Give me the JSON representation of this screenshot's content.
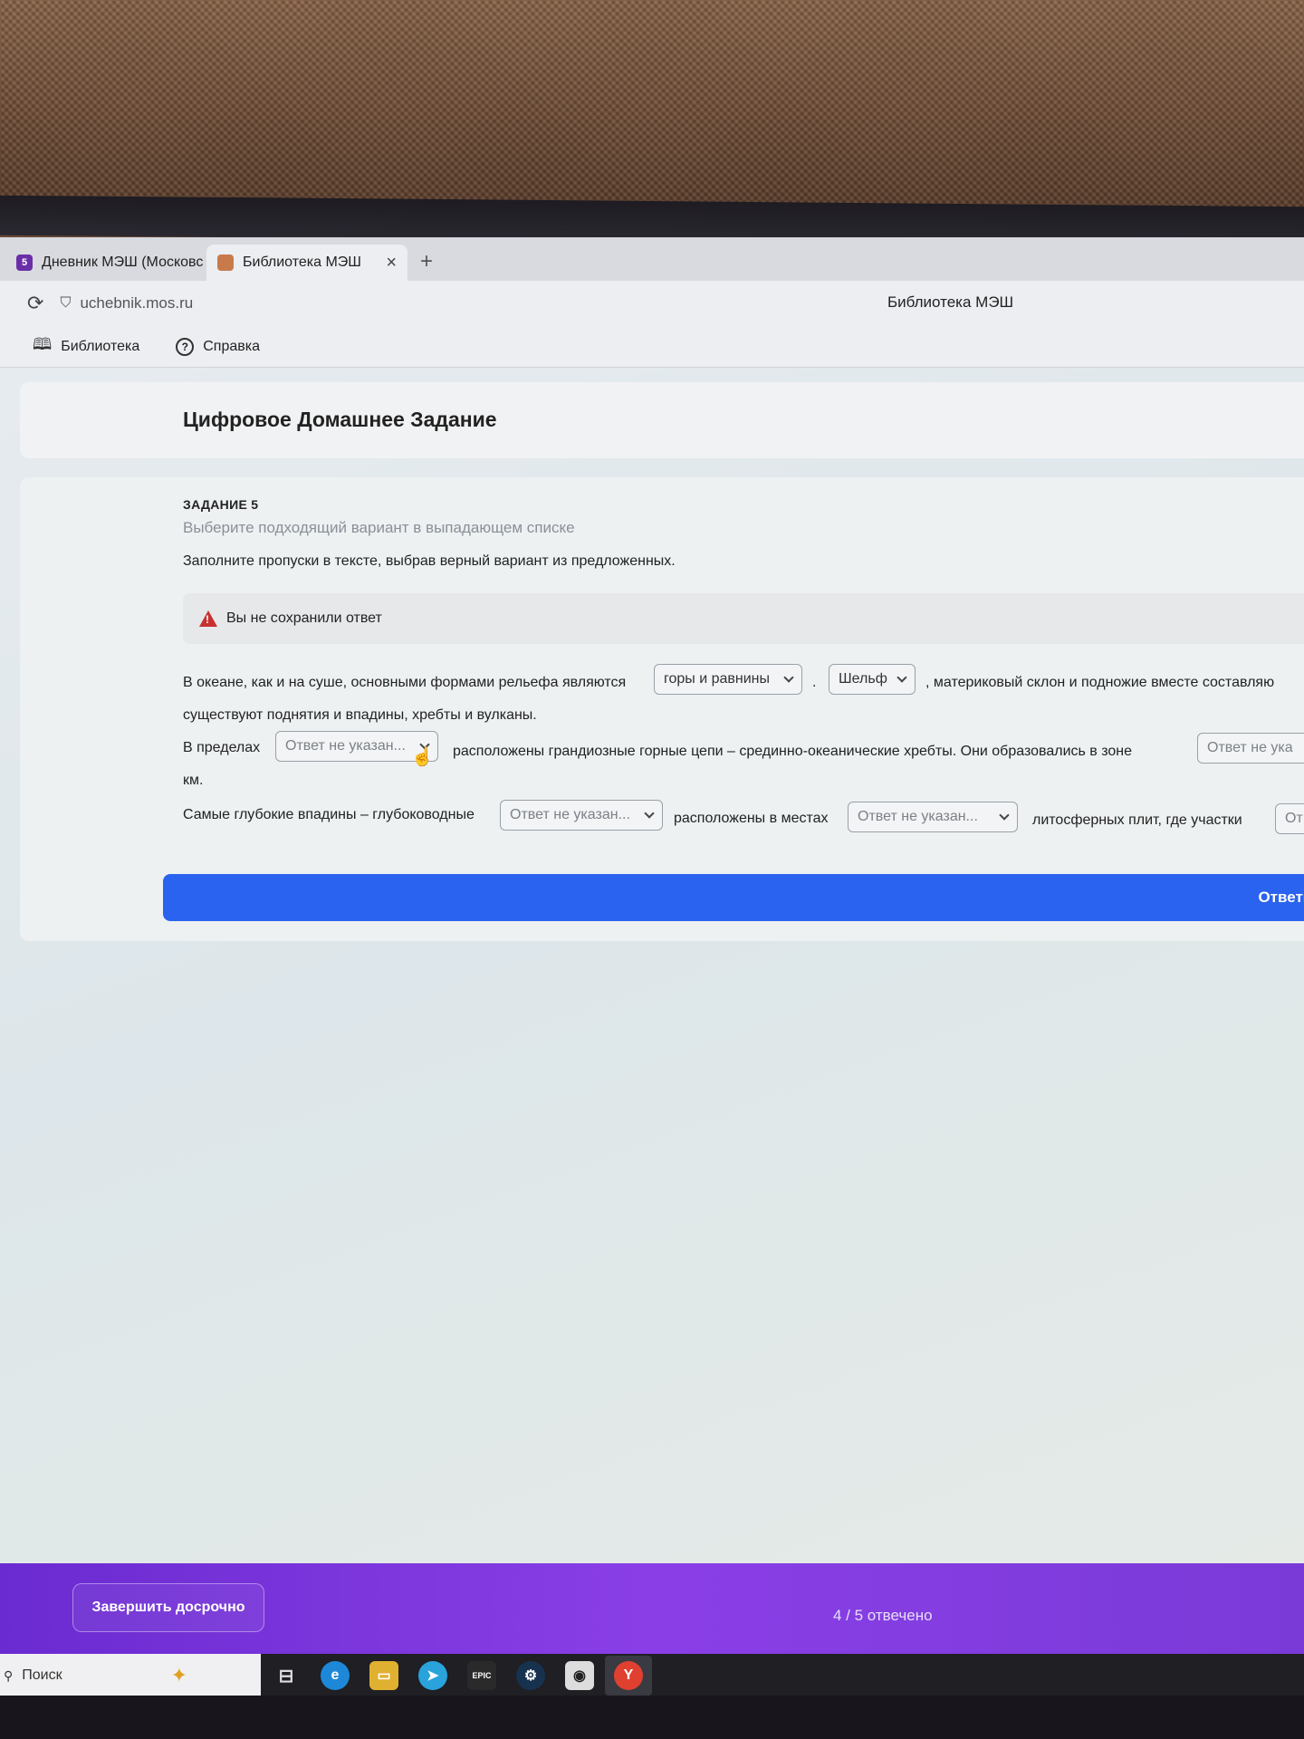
{
  "browser": {
    "tabs": [
      {
        "label": "Дневник МЭШ (Московс",
        "favicon": "5"
      },
      {
        "label": "Библиотека МЭШ",
        "close": "×"
      }
    ],
    "new_tab": "+",
    "url": "uchebnik.mos.ru",
    "page_title": "Библиотека МЭШ"
  },
  "bookmarks": [
    {
      "label": "Библиотека",
      "icon": "book-icon"
    },
    {
      "label": "Справка",
      "icon": "help-icon"
    }
  ],
  "header": {
    "title": "Цифровое Домашнее Задание"
  },
  "task": {
    "label": "ЗАДАНИЕ 5",
    "hint": "Выберите подходящий вариант в выпадающем списке",
    "instruction": "Заполните пропуски в тексте, выбрав верный вариант из предложенных.",
    "warning": "Вы не сохранили ответ",
    "line1_start": "В океане, как и на суше, основными формами рельефа являются",
    "dd1": "горы и равнины",
    "sep1": ".",
    "dd2": "Шельф",
    "line1_end": ", материковый склон и подножие вместе составляю",
    "line2": "существуют поднятия и впадины, хребты и вулканы.",
    "line3_start": "В пределах",
    "dd3": "Ответ не указан...",
    "line3_mid": "расположены грандиозные горные цепи – срединно-океанические хребты. Они образовались в зоне",
    "dd4": "Ответ не ука",
    "line4": "км.",
    "line5_start": "Самые глубокие впадины – глубоководные",
    "dd5": "Ответ не указан...",
    "line5_mid": "расположены в местах",
    "dd6": "Ответ не указан...",
    "line5_end": "литосферных плит, где участки",
    "dd7": "От",
    "answer_button": "Ответить"
  },
  "footer": {
    "finish_button": "Завершить досрочно",
    "progress": "4 / 5 отвечено"
  },
  "taskbar": {
    "search": "Поиск",
    "epic_label": "EPIC"
  },
  "colors": {
    "accent": "#2a63ef",
    "footer": "#7a3ad8",
    "warning": "#c8302f"
  }
}
